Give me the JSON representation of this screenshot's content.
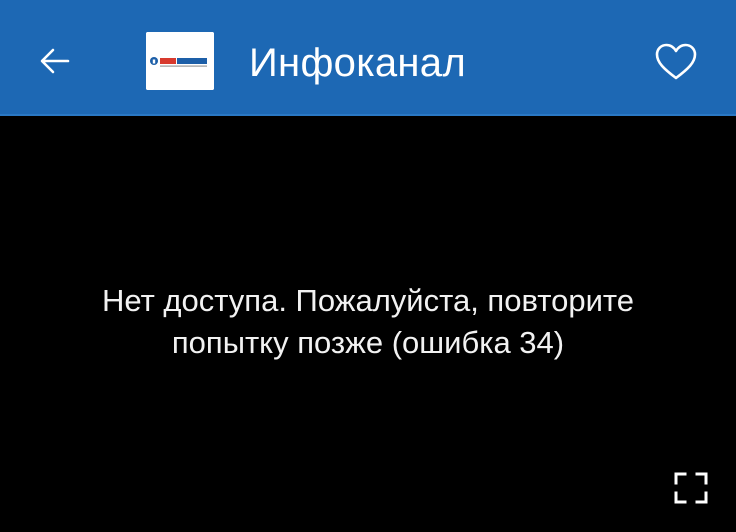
{
  "app_bar": {
    "title": "Инфоканал",
    "back_icon": "arrow-left-icon",
    "favorite_icon": "heart-outline-icon",
    "logo_icon": "infokanal-logo",
    "logo_text": "ИНФОКАНАЛ",
    "background_color": "#1d68b4"
  },
  "player": {
    "error_line_1": "Нет доступа. Пожалуйста, повторите",
    "error_line_2": "попытку позже (ошибка 34)",
    "fullscreen_icon": "fullscreen-icon",
    "background_color": "#000000"
  }
}
